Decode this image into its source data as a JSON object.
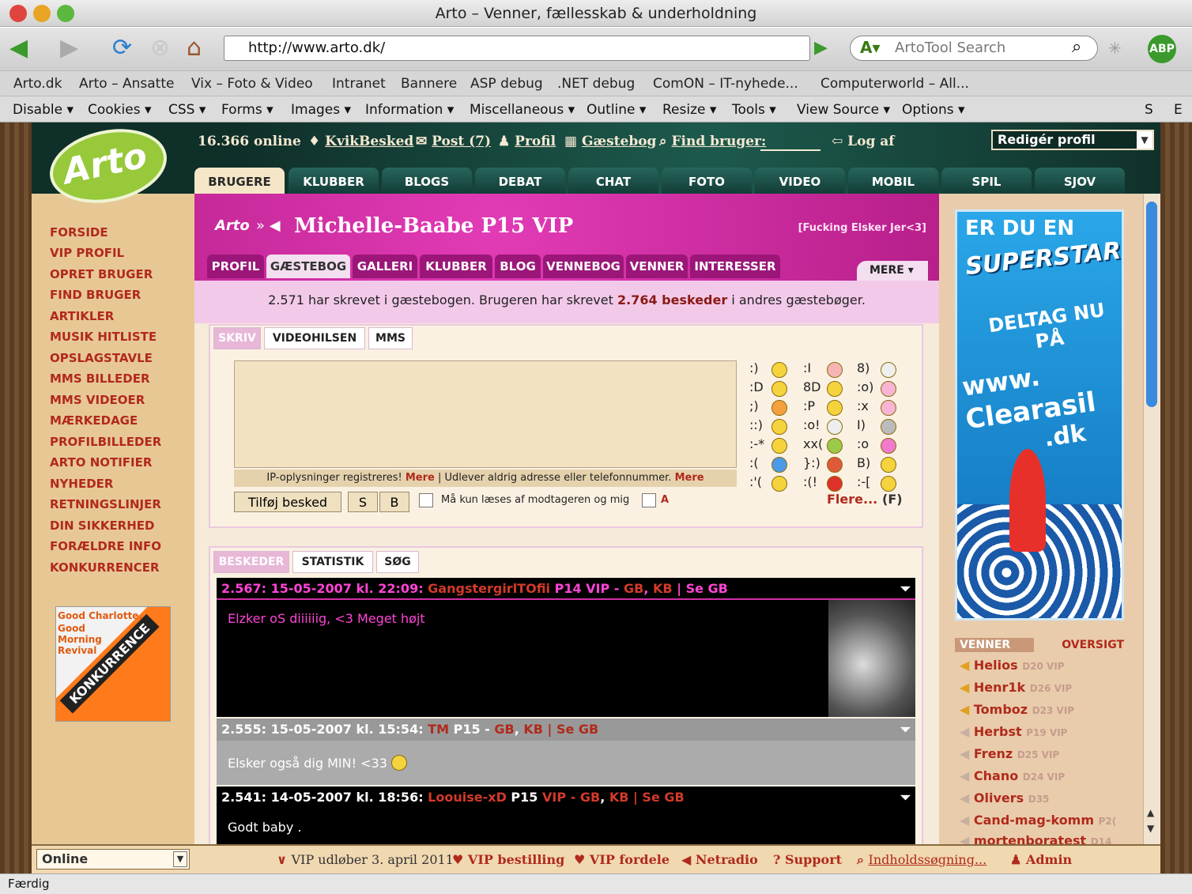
{
  "window": {
    "title": "Arto – Venner, fællesskab & underholdning"
  },
  "browser": {
    "url": "http://www.arto.dk/",
    "search_placeholder": "ArtoTool Search",
    "abp": "ABP"
  },
  "bookmarks": [
    "Arto.dk",
    "Arto – Ansatte",
    "Vix – Foto & Video",
    "Intranet",
    "Bannere",
    "ASP debug",
    ".NET debug",
    "ComON – IT-nyhede...",
    "Computerworld – All..."
  ],
  "devtools": [
    "Disable",
    "Cookies",
    "CSS",
    "Forms",
    "Images",
    "Information",
    "Miscellaneous",
    "Outline",
    "Resize",
    "Tools",
    "View Source",
    "Options"
  ],
  "devtools_right": [
    "S",
    "E"
  ],
  "top": {
    "online": "16.366 online",
    "kvik": "KvikBesked",
    "post": "Post (7)",
    "profil": "Profil",
    "gaestebog": "Gæstebog",
    "find": "Find bruger:",
    "logaf": "Log af",
    "rediger": "Redigér profil"
  },
  "logo": "Arto",
  "tabs": [
    "BRUGERE",
    "KLUBBER",
    "BLOGS",
    "DEBAT",
    "CHAT",
    "FOTO",
    "VIDEO",
    "MOBIL",
    "SPIL",
    "SJOV"
  ],
  "sidebar": [
    "FORSIDE",
    "VIP PROFIL",
    "OPRET BRUGER",
    "FIND BRUGER",
    "ARTIKLER",
    "MUSIK HITLISTE",
    "OPSLAGSTAVLE",
    "MMS BILLEDER",
    "MMS VIDEOER",
    "MÆRKEDAGE",
    "PROFILBILLEDER",
    "ARTO NOTIFIER",
    "NYHEDER",
    "RETNINGSLINJER",
    "DIN SIKKERHED",
    "FORÆLDRE INFO",
    "KONKURRENCER"
  ],
  "sidebar_ad": {
    "line1": "Good Charlotte.",
    "line2": "Good Morning Revival",
    "badge": "KONKURRENCE"
  },
  "profile": {
    "name": "Michelle-Baabe P15 VIP",
    "motto": "[Fucking Elsker Jer<3]",
    "more": "MERE"
  },
  "profile_tabs": [
    "PROFIL",
    "GÆSTEBOG",
    "GALLERI",
    "KLUBBER",
    "BLOG",
    "VENNEBOG",
    "VENNER",
    "INTERESSER"
  ],
  "gb_info": {
    "pre": "2.571 har skrevet i gæstebogen. Brugeren har skrevet ",
    "count": "2.764 beskeder",
    "post": " i andres gæstebøger."
  },
  "write_tabs": [
    "SKRIV",
    "VIDEOHILSEN",
    "MMS"
  ],
  "ip_note": {
    "text1": "IP-oplysninger registreres!",
    "more1": "Mere",
    "text2": "| Udlever aldrig adresse eller telefonnummer.",
    "more2": "Mere"
  },
  "buttons": {
    "add": "Tilføj besked",
    "s": "S",
    "b": "B",
    "private": "Må kun læses af modtageren og mig",
    "a": "A",
    "flere": "Flere...",
    "f": "(F)"
  },
  "smileys": [
    [
      ":)",
      ":I",
      "8)"
    ],
    [
      ":D",
      "8D",
      ":o)"
    ],
    [
      ";)",
      ":P",
      ":x"
    ],
    [
      "::)",
      ":o!",
      "I)"
    ],
    [
      ":-*",
      "xx(",
      ":o"
    ],
    [
      ":(",
      "}:)",
      "B)"
    ],
    [
      ":'(",
      ":(!",
      ":-["
    ]
  ],
  "msg_tabs": [
    "BESKEDER",
    "STATISTIK",
    "SØG"
  ],
  "messages": [
    {
      "head": "2.567: 15-05-2007 kl. 22:09:",
      "user": "GangstergirlTOfii",
      "tag": "P14 VIP -",
      "gb": "GB",
      "kb": "KB",
      "se": "| Se GB",
      "text": "Elzker oS diiiiiig, <3 Meget højt"
    },
    {
      "head": "2.555: 15-05-2007 kl. 15:54:",
      "user": "TM",
      "tag": "P15 -",
      "gb": "GB",
      "kb": "KB",
      "se": "| Se GB",
      "text": "Elsker også dig MIN! <33"
    },
    {
      "head": "2.541: 14-05-2007 kl. 18:56:",
      "user": "Loouise-xD",
      "tag": "P15",
      "vip": "VIP -",
      "gb": "GB",
      "kb": "KB",
      "se": "| Se GB",
      "text": "Godt baby ."
    }
  ],
  "ad": {
    "l1": "ER DU EN",
    "l2": "SUPERSTAR",
    "l3": "DELTAG NU PÅ",
    "l4": "www.",
    "l5": "Clearasil",
    "l6": ".dk"
  },
  "friends_tabs": [
    "VENNER",
    "OVERSIGT"
  ],
  "friends": [
    {
      "name": "Helios",
      "info": "D20 VIP"
    },
    {
      "name": "Henr1k",
      "info": "D26 VIP"
    },
    {
      "name": "Tomboz",
      "info": "D23 VIP"
    },
    {
      "name": "Herbst",
      "info": "P19 VIP"
    },
    {
      "name": "Frenz",
      "info": "D25 VIP"
    },
    {
      "name": "Chano",
      "info": "D24 VIP"
    },
    {
      "name": "Olivers",
      "info": "D35"
    },
    {
      "name": "Cand-mag-komm",
      "info": "P2("
    },
    {
      "name": "mortenboratest",
      "info": "D14"
    }
  ],
  "bottom": {
    "status": "Online",
    "vip": "VIP udløber 3. april 2011",
    "bestilling": "VIP bestilling",
    "fordele": "VIP fordele",
    "netradio": "Netradio",
    "support": "Support",
    "search": "Indholdssøgning...",
    "admin": "Admin"
  },
  "statusbar": "Færdig",
  "colors": {
    "accent_pink": "#d02fa5",
    "teal": "#1a4f46",
    "red_link": "#b02a1c"
  }
}
